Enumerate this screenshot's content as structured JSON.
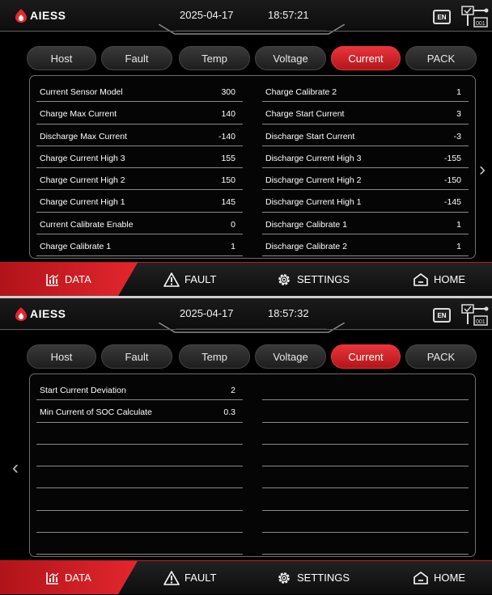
{
  "brand": "AIESS",
  "tabs": [
    "Host",
    "Fault",
    "Temp",
    "Voltage",
    "Current",
    "PACK"
  ],
  "active_tab": "Current",
  "language": "EN",
  "nav": {
    "data": "DATA",
    "fault": "FAULT",
    "settings": "SETTINGS",
    "home": "HOME"
  },
  "colors": {
    "accent": "#d8252b",
    "background": "#000000"
  },
  "screen1": {
    "date": "2025-04-17",
    "time": "18:57:21",
    "left": [
      {
        "label": "Current Sensor Model",
        "value": "300"
      },
      {
        "label": "Charge Max Current",
        "value": "140"
      },
      {
        "label": "Discharge Max Current",
        "value": "-140"
      },
      {
        "label": "Charge Current High 3",
        "value": "155"
      },
      {
        "label": "Charge Current High 2",
        "value": "150"
      },
      {
        "label": "Charge Current High 1",
        "value": "145"
      },
      {
        "label": "Current Calibrate Enable",
        "value": "0"
      },
      {
        "label": "Charge Calibrate 1",
        "value": "1"
      }
    ],
    "right": [
      {
        "label": "Charge Calibrate 2",
        "value": "1"
      },
      {
        "label": "Charge Start Current",
        "value": "3"
      },
      {
        "label": "Discharge Start Current",
        "value": "-3"
      },
      {
        "label": "Discharge Current High 3",
        "value": "-155"
      },
      {
        "label": "Discharge Current High 2",
        "value": "-150"
      },
      {
        "label": "Discharge Current High 1",
        "value": "-145"
      },
      {
        "label": "Discharge Calibrate 1",
        "value": "1"
      },
      {
        "label": "Discharge Calibrate 2",
        "value": "1"
      }
    ]
  },
  "screen2": {
    "date": "2025-04-17",
    "time": "18:57:32",
    "left": [
      {
        "label": "Start Current Deviation",
        "value": "2"
      },
      {
        "label": "Min Current of SOC Calculate",
        "value": "0.3"
      },
      {
        "label": "",
        "value": ""
      },
      {
        "label": "",
        "value": ""
      },
      {
        "label": "",
        "value": ""
      },
      {
        "label": "",
        "value": ""
      },
      {
        "label": "",
        "value": ""
      },
      {
        "label": "",
        "value": ""
      }
    ],
    "right": [
      {
        "label": "",
        "value": ""
      },
      {
        "label": "",
        "value": ""
      },
      {
        "label": "",
        "value": ""
      },
      {
        "label": "",
        "value": ""
      },
      {
        "label": "",
        "value": ""
      },
      {
        "label": "",
        "value": ""
      },
      {
        "label": "",
        "value": ""
      },
      {
        "label": "",
        "value": ""
      }
    ]
  }
}
